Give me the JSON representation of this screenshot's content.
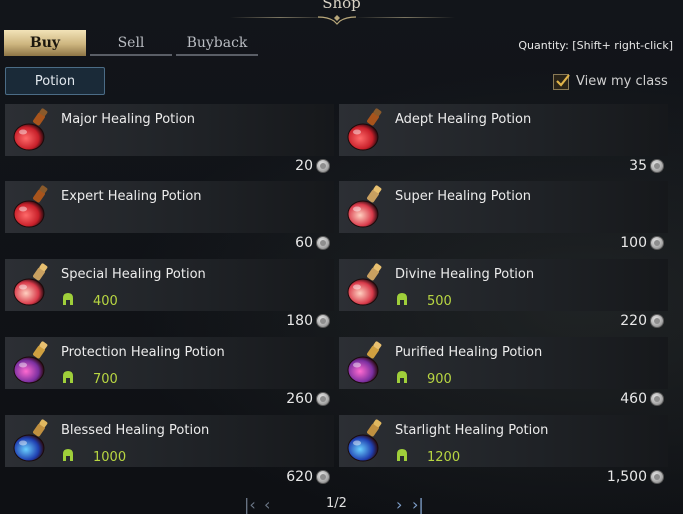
{
  "title": "Shop",
  "tabs": [
    {
      "label": "Buy",
      "active": true
    },
    {
      "label": "Sell",
      "active": false
    },
    {
      "label": "Buyback",
      "active": false
    }
  ],
  "quantity_hint": "Quantity: [Shift+ right-click]",
  "filter_label": "Potion",
  "view_my_class": {
    "label": "View my class",
    "checked": true
  },
  "items": [
    {
      "name": "Major Healing Potion",
      "price": "20",
      "requirement": "",
      "icon": "red-potion-icon"
    },
    {
      "name": "Adept Healing Potion",
      "price": "35",
      "requirement": "",
      "icon": "red-potion-icon"
    },
    {
      "name": "Expert Healing Potion",
      "price": "60",
      "requirement": "",
      "icon": "red-potion-icon"
    },
    {
      "name": "Super Healing Potion",
      "price": "100",
      "requirement": "",
      "icon": "pink-potion-icon"
    },
    {
      "name": "Special Healing Potion",
      "price": "180",
      "requirement": "400",
      "icon": "pink-potion-icon"
    },
    {
      "name": "Divine Healing Potion",
      "price": "220",
      "requirement": "500",
      "icon": "pink-potion-icon"
    },
    {
      "name": "Protection Healing Potion",
      "price": "260",
      "requirement": "700",
      "icon": "purple-potion-icon"
    },
    {
      "name": "Purified Healing Potion",
      "price": "460",
      "requirement": "900",
      "icon": "purple-potion-icon"
    },
    {
      "name": "Blessed Healing Potion",
      "price": "620",
      "requirement": "1000",
      "icon": "blue-potion-icon"
    },
    {
      "name": "Starlight Healing Potion",
      "price": "1,500",
      "requirement": "1200",
      "icon": "blue-potion-icon"
    }
  ],
  "pagination": {
    "text": "1/2"
  },
  "colors": {
    "accent": "#cdb57f",
    "requirement": "#b8d642",
    "filter_border": "#4b6c86"
  }
}
